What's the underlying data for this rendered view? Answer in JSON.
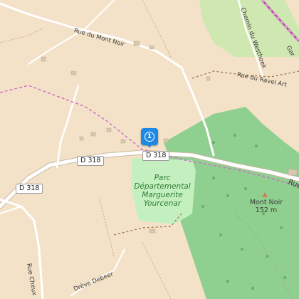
{
  "roads": {
    "rue_du_mont_noir": "Rue du Mont Noir",
    "chemin_westhoek": "Chemin du Westhoek",
    "rue_du_ravel_art": "Rue du Ravel Art",
    "rue_cheux": "Rue Cheux",
    "dreve_debeer": "Drève Debeer",
    "rue_edge": "Rue",
    "gar_edge": "Gar"
  },
  "shields": {
    "d318_a": "D 318",
    "d318_b": "D 318",
    "d318_c": "D 318"
  },
  "park": {
    "name": "Parc Départemental Marguerite Yourcenar"
  },
  "peak": {
    "name": "Mont Noir",
    "elevation": "152 m"
  },
  "marker": {
    "number": "1"
  },
  "colors": {
    "background": "#f4e2c8",
    "forest": "#8fcf8f",
    "park": "#c4f0c0",
    "road": "#ffffff",
    "trail": "#d070c8",
    "railway": "#c050b0",
    "marker": "#1e88e5"
  }
}
